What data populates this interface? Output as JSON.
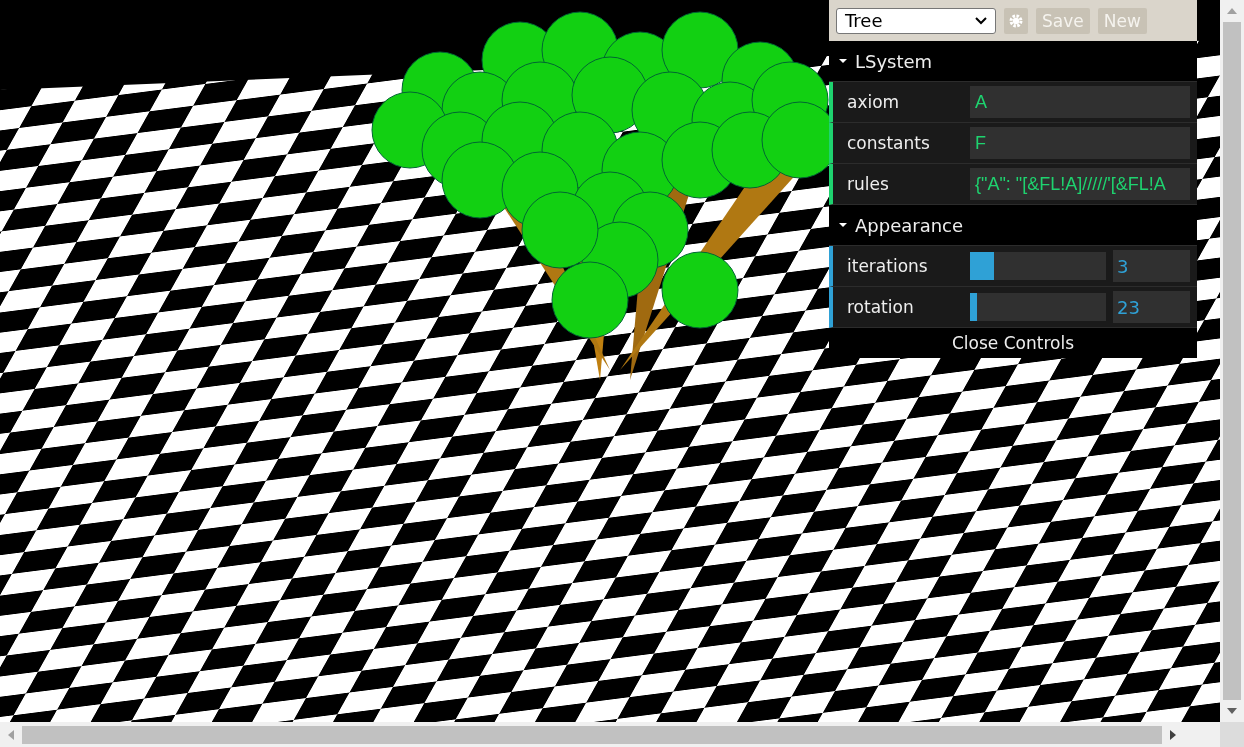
{
  "presets": {
    "value": "Tree",
    "buttons": [
      {
        "kind": "gear"
      },
      {
        "kind": "text",
        "label": "Save"
      },
      {
        "kind": "text",
        "label": "New"
      }
    ]
  },
  "folders": [
    {
      "title": "LSystem",
      "expanded": true,
      "controls": [
        {
          "kind": "string",
          "label": "axiom",
          "value": "A"
        },
        {
          "kind": "string",
          "label": "constants",
          "value": "F"
        },
        {
          "kind": "string",
          "label": "rules",
          "value": "{\"A\": \"[&FL!A]/////'[&FL!A"
        }
      ]
    },
    {
      "title": "Appearance",
      "expanded": true,
      "controls": [
        {
          "kind": "number",
          "label": "iterations",
          "value": "3",
          "level": 0.18
        },
        {
          "kind": "number",
          "label": "rotation",
          "value": "23",
          "level": 0.05
        }
      ]
    }
  ],
  "close_label": "Close Controls"
}
